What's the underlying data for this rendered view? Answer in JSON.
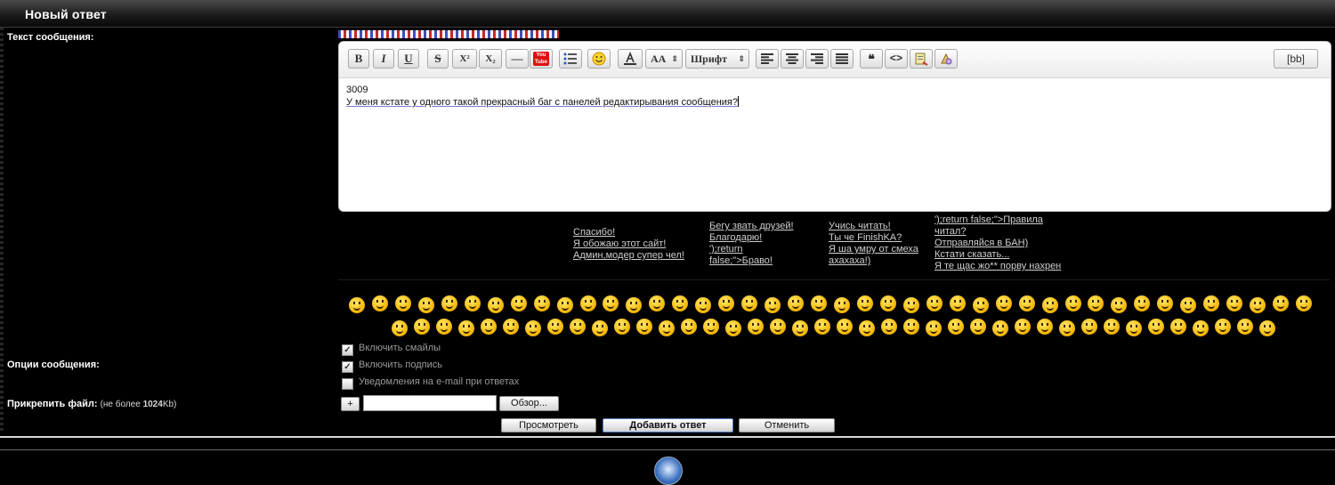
{
  "header": {
    "title": "Новый ответ"
  },
  "labels": {
    "message_text": "Текст сообщения:",
    "message_options": "Опции сообщения:",
    "attach_file": "Прикрепить файл:",
    "attach_note_prefix": "(не более ",
    "attach_size": "1024",
    "attach_note_suffix": "Kb)"
  },
  "toolbar": {
    "bold": "B",
    "italic": "I",
    "underline": "U",
    "strike": "S",
    "superscript": "X²",
    "subscript": "X₂",
    "hr": "—",
    "youtube": "You Tube",
    "size_select": "AA",
    "font_select": "Шрифт",
    "bb_toggle": "[bb]"
  },
  "editor": {
    "line1": "3009",
    "line2": "У меня кстате у одного такой прекрасный баг с панелей редактирывания сообщения?"
  },
  "quick_phrases": [
    [
      "Спасибо!",
      "Я обожаю этот сайт!",
      "Админ,модер супер чел!"
    ],
    [
      "Бегу звать друзей!",
      "Благодарю!",
      "');return",
      "false;\">Браво!"
    ],
    [
      "Учись читать!",
      "Ты че FinishKA?",
      "Я ша умру от смеха",
      "ахахаха!)"
    ],
    [
      "');return false;\">Правила",
      "читал?",
      "Отправляйся в БАН)",
      "Кстати сказать...",
      "Я те щас жо** порву нахрен"
    ]
  ],
  "options": {
    "enable_smileys": "Включить смайлы",
    "enable_signature": "Включить подпись",
    "email_notify": "Уведомления на e-mail при ответах",
    "enable_smileys_checked": true,
    "enable_signature_checked": true,
    "email_notify_checked": false
  },
  "attach": {
    "add_button": "+",
    "browse_button": "Обзор..."
  },
  "actions": {
    "preview": "Просмотреть",
    "submit": "Добавить ответ",
    "cancel": "Отменить"
  },
  "smileys_count_row1": 42,
  "smileys_count_row2": 40,
  "colors": {
    "background": "#000000",
    "editor_bg": "#ffffff",
    "link": "#cfcfcf"
  }
}
